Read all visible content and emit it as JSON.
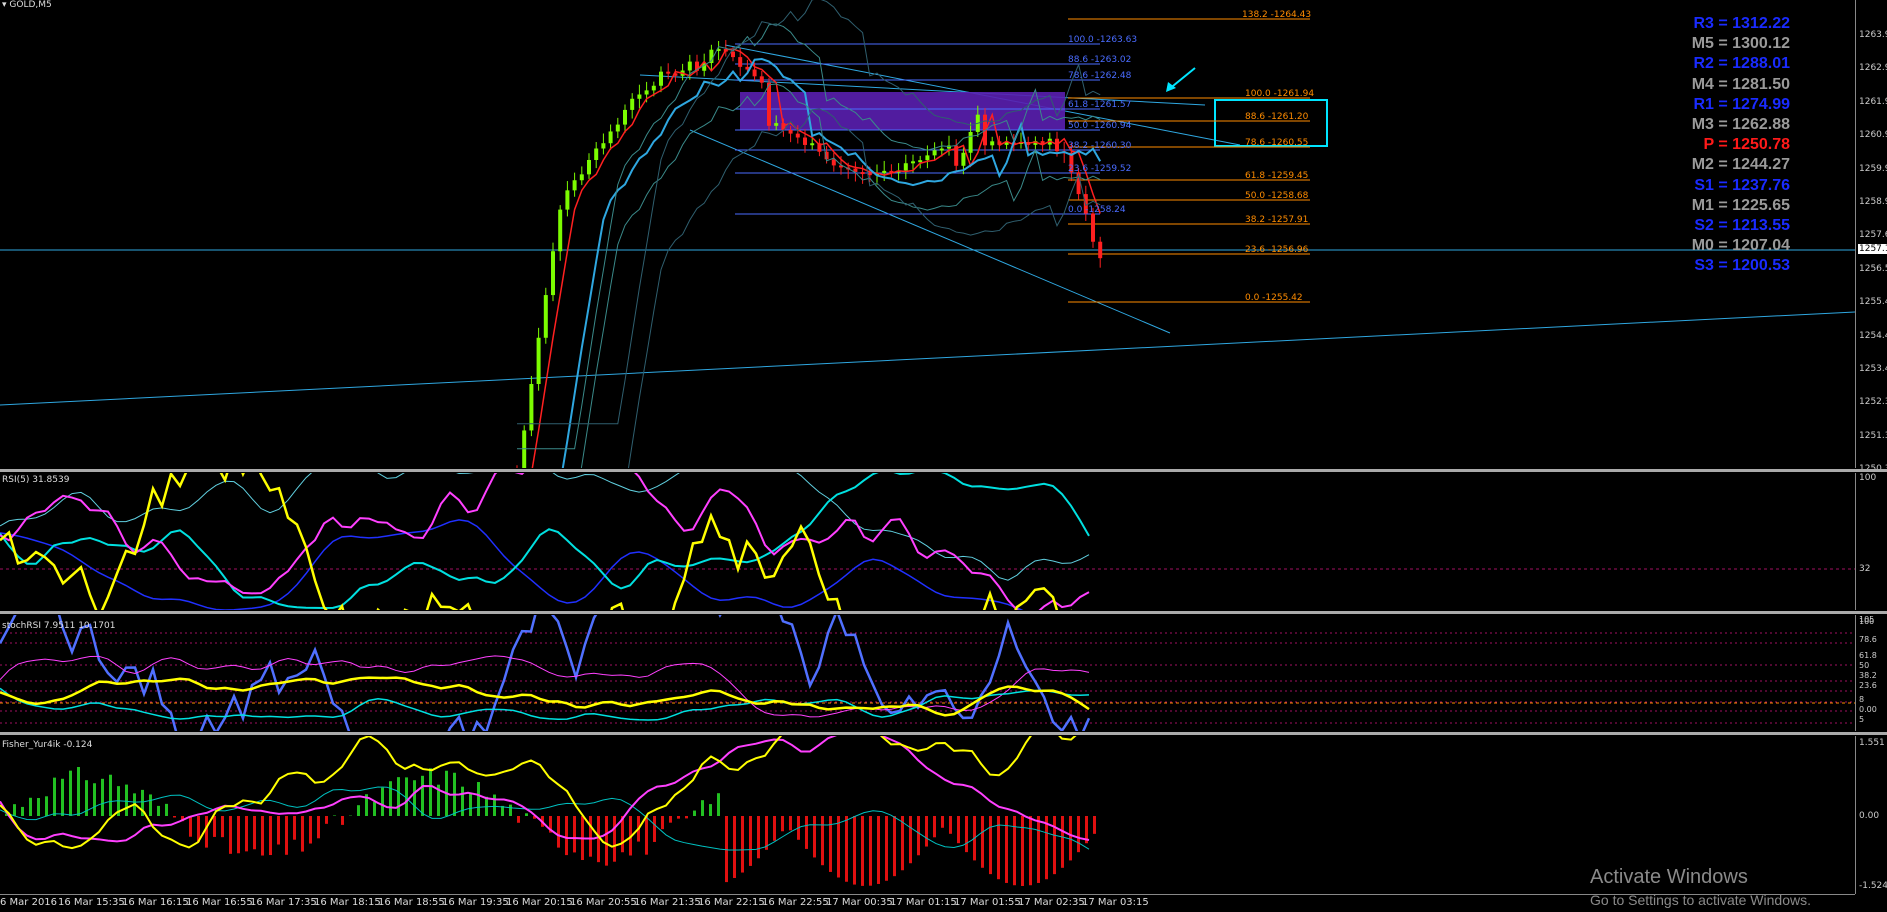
{
  "symbol_title": "GOLD,M5",
  "price_axis": [
    "1263.9",
    "1262.9",
    "1261.9",
    "1260.9",
    "1259.9",
    "1258.9",
    "1257.6",
    "1256.5",
    "1255.4",
    "1254.4",
    "1253.4",
    "1252.3",
    "1251.3",
    "1250.3"
  ],
  "current_price": "1257.1",
  "pivots": [
    {
      "label": "R3 = 1312.22",
      "color": "#1a2bff"
    },
    {
      "label": "M5 = 1300.12",
      "color": "#9a9a9a"
    },
    {
      "label": "R2 = 1288.01",
      "color": "#1a2bff"
    },
    {
      "label": "M4 = 1281.50",
      "color": "#9a9a9a"
    },
    {
      "label": "R1 = 1274.99",
      "color": "#1a2bff"
    },
    {
      "label": "M3 = 1262.88",
      "color": "#9a9a9a"
    },
    {
      "label": "P  = 1250.78",
      "color": "#ff1a1a"
    },
    {
      "label": "M2 = 1244.27",
      "color": "#9a9a9a"
    },
    {
      "label": "S1 = 1237.76",
      "color": "#1a2bff"
    },
    {
      "label": "M1 = 1225.65",
      "color": "#9a9a9a"
    },
    {
      "label": "S2 = 1213.55",
      "color": "#1a2bff"
    },
    {
      "label": "M0 = 1207.04",
      "color": "#9a9a9a"
    },
    {
      "label": "S3 = 1200.53",
      "color": "#1a2bff"
    }
  ],
  "fib_orange": [
    "138.2 -1264.43",
    "100.0 -1261.94",
    "88.6 -1261.20",
    "78.6 -1260.55",
    "61.8 -1259.45",
    "50.0 -1258.68",
    "38.2 -1257.91",
    "23.6 -1256.96",
    "0.0 -1255.42"
  ],
  "fib_blue": [
    "100.0 -1263.63",
    "88.6 -1263.02",
    "78.6 -1262.48",
    "61.8 -1261.57",
    "50.0 -1260.94",
    "38.2 -1260.30",
    "23.6 -1259.52",
    "0.0 -1258.24"
  ],
  "rsi": {
    "title": "RSI(5) 31.8539",
    "axis": [
      "100",
      "32"
    ]
  },
  "stoch": {
    "title": "stochRSI 7.9511 10.1701",
    "axis": [
      "105",
      "100",
      "78.6",
      "61.8",
      "50",
      "38.2",
      "23.6",
      "8",
      "0.00",
      "5"
    ]
  },
  "fisher": {
    "title": "Fisher_Yur4ik -0.124",
    "axis": [
      "1.551",
      "0.00",
      "-1.524"
    ]
  },
  "time_axis": [
    "6 Mar 2016",
    "16 Mar 15:35",
    "16 Mar 16:15",
    "16 Mar 16:55",
    "16 Mar 17:35",
    "16 Mar 18:15",
    "16 Mar 18:55",
    "16 Mar 19:35",
    "16 Mar 20:15",
    "16 Mar 20:55",
    "16 Mar 21:35",
    "16 Mar 22:15",
    "16 Mar 22:55",
    "17 Mar 00:35",
    "17 Mar 01:15",
    "17 Mar 01:55",
    "17 Mar 02:35",
    "17 Mar 03:15"
  ],
  "watermark": {
    "line1": "Activate Windows",
    "line2": "Go to Settings to activate Windows."
  },
  "colors": {
    "bull": "#7cfc00",
    "bear": "#ff2020",
    "rsi": "#ffff00",
    "fib_orange": "#ff8c00",
    "fib_blue": "#4a6cff",
    "trend": "#2fa7e0",
    "box": "#00e5ff"
  }
}
